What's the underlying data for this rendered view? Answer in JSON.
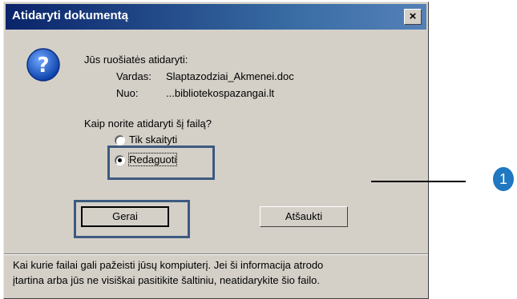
{
  "dialog": {
    "title": "Atidaryti dokumentą",
    "close_label": "×",
    "icon": "question-icon",
    "intro": "Jūs ruošiatės atidaryti:",
    "name_label": "Vardas:",
    "name_value": "Slaptazodziai_Akmenei.doc",
    "from_label": "Nuo:",
    "from_value": "...bibliotekospazangai.lt",
    "prompt": "Kaip norite atidaryti šį failą?",
    "options": [
      {
        "label": "Tik skaityti",
        "selected": false
      },
      {
        "label": "Redaguoti",
        "selected": true
      }
    ],
    "ok_label": "Gerai",
    "cancel_label": "Atšaukti",
    "warning_line1": "Kai kurie failai gali pažeisti jūsų kompiuterį. Jei ši informacija atrodo",
    "warning_line2": "įtartina arba jūs ne visiškai pasitikite šaltiniu, neatidarykite šio failo."
  },
  "callout": {
    "number": "1"
  },
  "colors": {
    "titlebar": "#0a246a",
    "highlight": "#3d5a80",
    "callout": "#1f78c1",
    "dialog_bg": "#d4d0c8"
  }
}
